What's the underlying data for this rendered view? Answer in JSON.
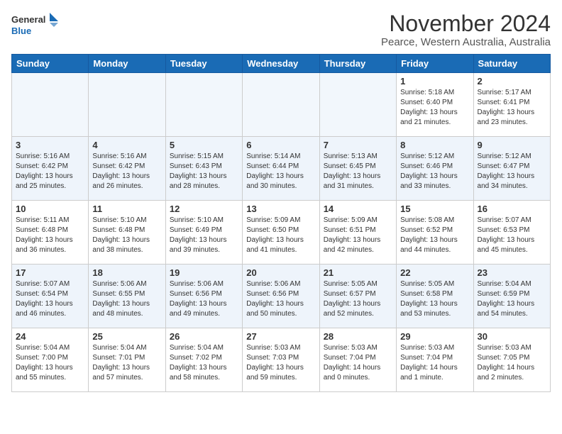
{
  "logo": {
    "line1": "General",
    "line2": "Blue"
  },
  "title": "November 2024",
  "location": "Pearce, Western Australia, Australia",
  "days_of_week": [
    "Sunday",
    "Monday",
    "Tuesday",
    "Wednesday",
    "Thursday",
    "Friday",
    "Saturday"
  ],
  "weeks": [
    [
      {
        "day": "",
        "info": ""
      },
      {
        "day": "",
        "info": ""
      },
      {
        "day": "",
        "info": ""
      },
      {
        "day": "",
        "info": ""
      },
      {
        "day": "",
        "info": ""
      },
      {
        "day": "1",
        "info": "Sunrise: 5:18 AM\nSunset: 6:40 PM\nDaylight: 13 hours\nand 21 minutes."
      },
      {
        "day": "2",
        "info": "Sunrise: 5:17 AM\nSunset: 6:41 PM\nDaylight: 13 hours\nand 23 minutes."
      }
    ],
    [
      {
        "day": "3",
        "info": "Sunrise: 5:16 AM\nSunset: 6:42 PM\nDaylight: 13 hours\nand 25 minutes."
      },
      {
        "day": "4",
        "info": "Sunrise: 5:16 AM\nSunset: 6:42 PM\nDaylight: 13 hours\nand 26 minutes."
      },
      {
        "day": "5",
        "info": "Sunrise: 5:15 AM\nSunset: 6:43 PM\nDaylight: 13 hours\nand 28 minutes."
      },
      {
        "day": "6",
        "info": "Sunrise: 5:14 AM\nSunset: 6:44 PM\nDaylight: 13 hours\nand 30 minutes."
      },
      {
        "day": "7",
        "info": "Sunrise: 5:13 AM\nSunset: 6:45 PM\nDaylight: 13 hours\nand 31 minutes."
      },
      {
        "day": "8",
        "info": "Sunrise: 5:12 AM\nSunset: 6:46 PM\nDaylight: 13 hours\nand 33 minutes."
      },
      {
        "day": "9",
        "info": "Sunrise: 5:12 AM\nSunset: 6:47 PM\nDaylight: 13 hours\nand 34 minutes."
      }
    ],
    [
      {
        "day": "10",
        "info": "Sunrise: 5:11 AM\nSunset: 6:48 PM\nDaylight: 13 hours\nand 36 minutes."
      },
      {
        "day": "11",
        "info": "Sunrise: 5:10 AM\nSunset: 6:48 PM\nDaylight: 13 hours\nand 38 minutes."
      },
      {
        "day": "12",
        "info": "Sunrise: 5:10 AM\nSunset: 6:49 PM\nDaylight: 13 hours\nand 39 minutes."
      },
      {
        "day": "13",
        "info": "Sunrise: 5:09 AM\nSunset: 6:50 PM\nDaylight: 13 hours\nand 41 minutes."
      },
      {
        "day": "14",
        "info": "Sunrise: 5:09 AM\nSunset: 6:51 PM\nDaylight: 13 hours\nand 42 minutes."
      },
      {
        "day": "15",
        "info": "Sunrise: 5:08 AM\nSunset: 6:52 PM\nDaylight: 13 hours\nand 44 minutes."
      },
      {
        "day": "16",
        "info": "Sunrise: 5:07 AM\nSunset: 6:53 PM\nDaylight: 13 hours\nand 45 minutes."
      }
    ],
    [
      {
        "day": "17",
        "info": "Sunrise: 5:07 AM\nSunset: 6:54 PM\nDaylight: 13 hours\nand 46 minutes."
      },
      {
        "day": "18",
        "info": "Sunrise: 5:06 AM\nSunset: 6:55 PM\nDaylight: 13 hours\nand 48 minutes."
      },
      {
        "day": "19",
        "info": "Sunrise: 5:06 AM\nSunset: 6:56 PM\nDaylight: 13 hours\nand 49 minutes."
      },
      {
        "day": "20",
        "info": "Sunrise: 5:06 AM\nSunset: 6:56 PM\nDaylight: 13 hours\nand 50 minutes."
      },
      {
        "day": "21",
        "info": "Sunrise: 5:05 AM\nSunset: 6:57 PM\nDaylight: 13 hours\nand 52 minutes."
      },
      {
        "day": "22",
        "info": "Sunrise: 5:05 AM\nSunset: 6:58 PM\nDaylight: 13 hours\nand 53 minutes."
      },
      {
        "day": "23",
        "info": "Sunrise: 5:04 AM\nSunset: 6:59 PM\nDaylight: 13 hours\nand 54 minutes."
      }
    ],
    [
      {
        "day": "24",
        "info": "Sunrise: 5:04 AM\nSunset: 7:00 PM\nDaylight: 13 hours\nand 55 minutes."
      },
      {
        "day": "25",
        "info": "Sunrise: 5:04 AM\nSunset: 7:01 PM\nDaylight: 13 hours\nand 57 minutes."
      },
      {
        "day": "26",
        "info": "Sunrise: 5:04 AM\nSunset: 7:02 PM\nDaylight: 13 hours\nand 58 minutes."
      },
      {
        "day": "27",
        "info": "Sunrise: 5:03 AM\nSunset: 7:03 PM\nDaylight: 13 hours\nand 59 minutes."
      },
      {
        "day": "28",
        "info": "Sunrise: 5:03 AM\nSunset: 7:04 PM\nDaylight: 14 hours\nand 0 minutes."
      },
      {
        "day": "29",
        "info": "Sunrise: 5:03 AM\nSunset: 7:04 PM\nDaylight: 14 hours\nand 1 minute."
      },
      {
        "day": "30",
        "info": "Sunrise: 5:03 AM\nSunset: 7:05 PM\nDaylight: 14 hours\nand 2 minutes."
      }
    ]
  ]
}
